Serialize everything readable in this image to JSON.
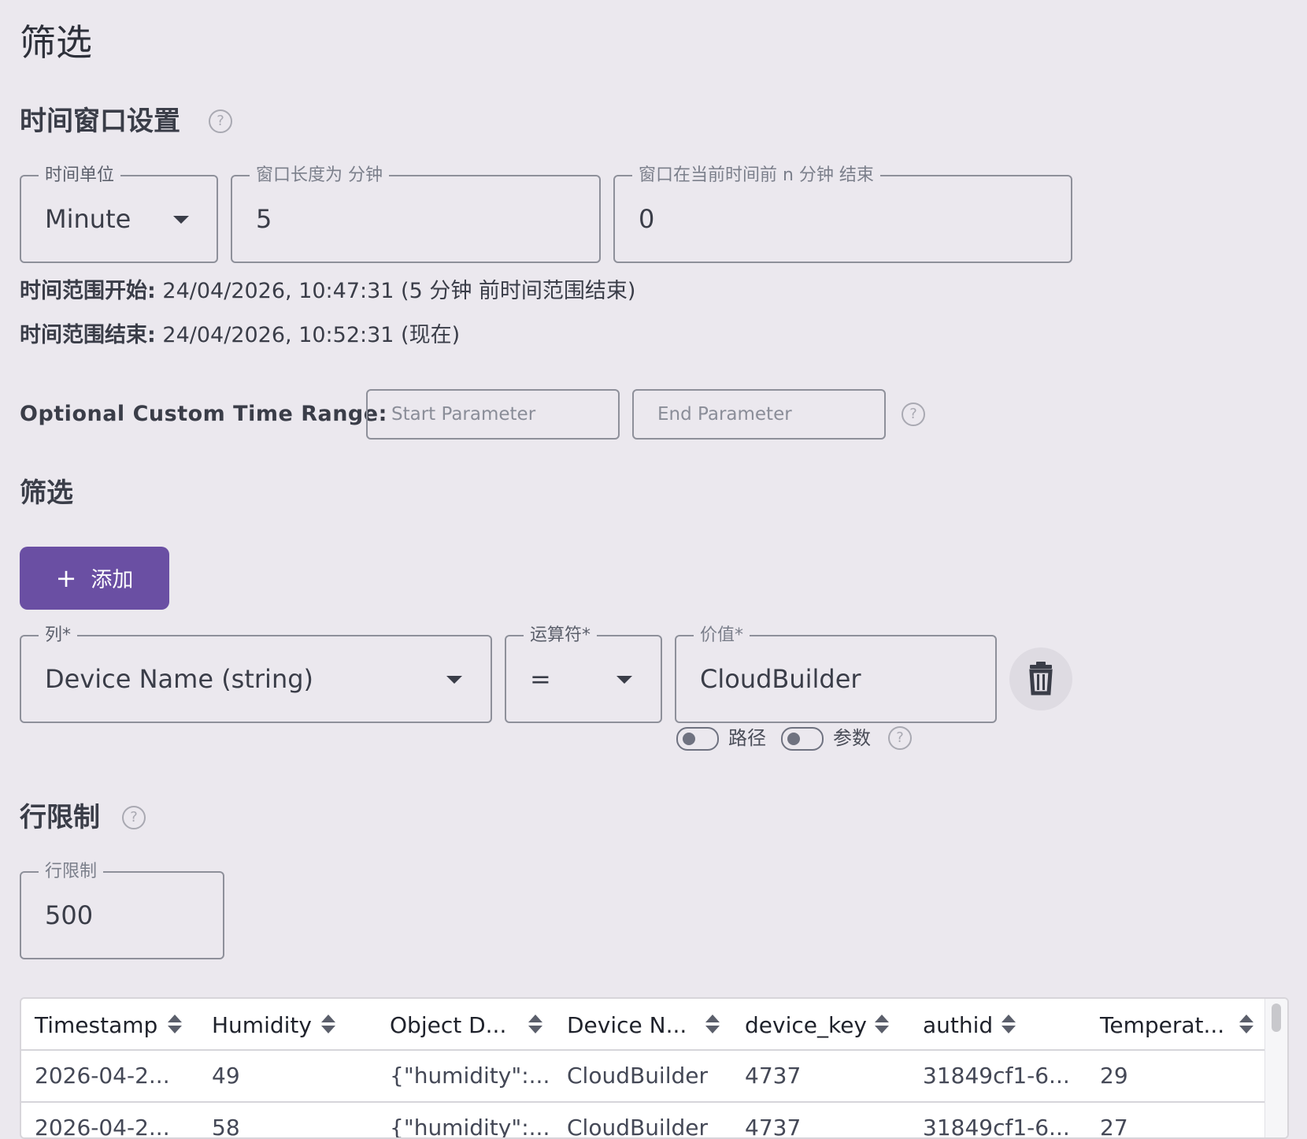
{
  "page_title": "筛选",
  "time_window": {
    "title": "时间窗口设置",
    "help_icon": "?",
    "unit_label": "时间单位",
    "unit_value": "Minute",
    "length_label": "窗口长度为 分钟",
    "length_value": "5",
    "offset_label": "窗口在当前时间前 n 分钟 结束",
    "offset_value": "0",
    "range_start_label": "时间范围开始:",
    "range_start_value": "24/04/2026, 10:47:31 (5 分钟 前时间范围结束)",
    "range_end_label": "时间范围结束:",
    "range_end_value": "24/04/2026, 10:52:31 (现在)"
  },
  "custom_range": {
    "label": "Optional Custom Time Range:",
    "start_placeholder": "Start Parameter",
    "end_placeholder": "End Parameter",
    "help_icon": "?"
  },
  "filters": {
    "title": "筛选",
    "add_plus": "+",
    "add_label": "添加",
    "column_label": "列*",
    "column_value": "Device Name (string)",
    "operator_label": "运算符*",
    "operator_value": "=",
    "value_label": "价值*",
    "value_value": "CloudBuilder",
    "toggle_path_label": "路径",
    "toggle_param_label": "参数",
    "help_icon": "?"
  },
  "row_limit": {
    "title": "行限制",
    "help_icon": "?",
    "field_label": "行限制",
    "field_value": "500"
  },
  "table": {
    "headers": [
      "Timestamp",
      "Humidity",
      "Object D...",
      "Device N...",
      "device_key",
      "authid",
      "Temperat..."
    ],
    "rows": [
      [
        "2026-04-2...",
        "49",
        "{\"humidity\":...",
        "CloudBuilder",
        "4737",
        "31849cf1-6...",
        "29"
      ],
      [
        "2026-04-2...",
        "58",
        "{\"humidity\":...",
        "CloudBuilder",
        "4737",
        "31849cf1-6...",
        "27"
      ]
    ]
  }
}
